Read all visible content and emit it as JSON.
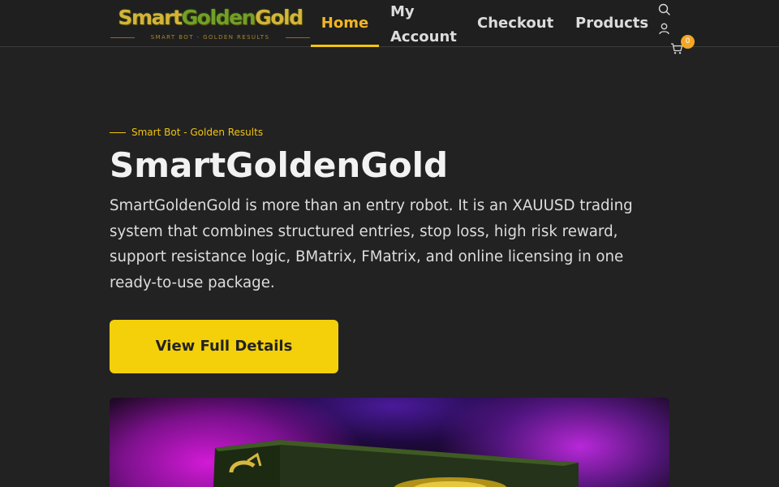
{
  "header": {
    "logo": {
      "text_part1": "Smart",
      "text_part2": "Golden",
      "text_part3": "Gold",
      "tagline": "SMART BOT - GOLDEN RESULTS"
    },
    "nav": {
      "home": "Home",
      "account": "My Account",
      "checkout": "Checkout",
      "products": "Products"
    },
    "icons": {
      "search": "search-icon",
      "user": "user-icon",
      "cart": "cart-icon"
    },
    "cart_count": "0",
    "colors": {
      "active_nav": "#f1b524",
      "badge": "#f5a623"
    }
  },
  "hero": {
    "eyebrow": "Smart Bot - Golden Results",
    "title": "SmartGoldenGold",
    "description": "SmartGoldenGold is more than an entry robot. It is an XAUUSD trading system that combines structured entries, stop loss, high risk reward, support resistance logic, BMatrix, FMatrix, and online licensing in one ready-to-use package.",
    "cta_label": "View Full Details",
    "colors": {
      "accent": "#f4d00b",
      "background": "#222222"
    }
  }
}
